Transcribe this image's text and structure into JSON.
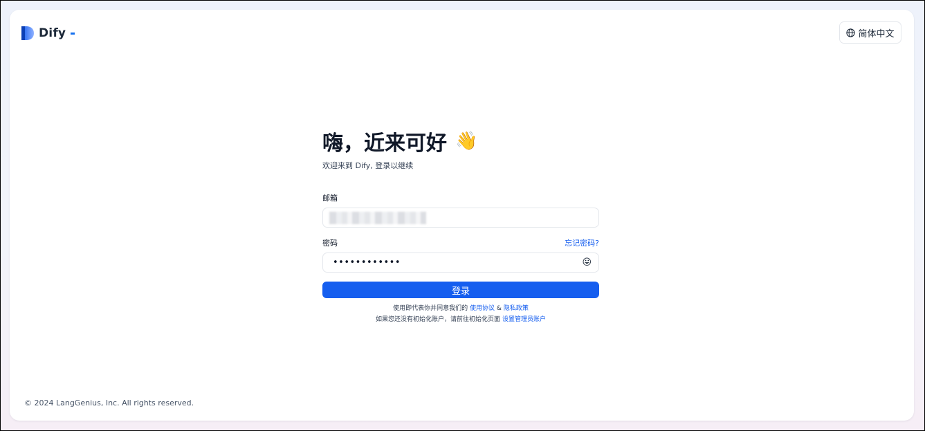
{
  "brand": {
    "name": "Dify",
    "accent_color": "#155eef",
    "logo_icon": "dify-logo-icon"
  },
  "header": {
    "language_icon": "globe-icon",
    "language_label": "简体中文"
  },
  "login": {
    "greeting": "嗨，近来可好",
    "greeting_emoji": "👋",
    "subtitle": "欢迎来到 Dify, 登录以继续",
    "email_label": "邮箱",
    "email_value": "",
    "password_label": "密码",
    "forgot_password": "忘记密码?",
    "password_value": "••••••••••••",
    "password_toggle_icon": "😛",
    "submit_label": "登录",
    "terms_prefix": "使用即代表你并同意我们的",
    "terms_link": "使用协议",
    "terms_amp": "&",
    "privacy_link": "隐私政策",
    "setup_prefix": "如果您还没有初始化账户，请前往初始化页面",
    "setup_link": "设置管理员账户"
  },
  "footer": {
    "copyright": "© 2024 LangGenius, Inc. All rights reserved."
  }
}
